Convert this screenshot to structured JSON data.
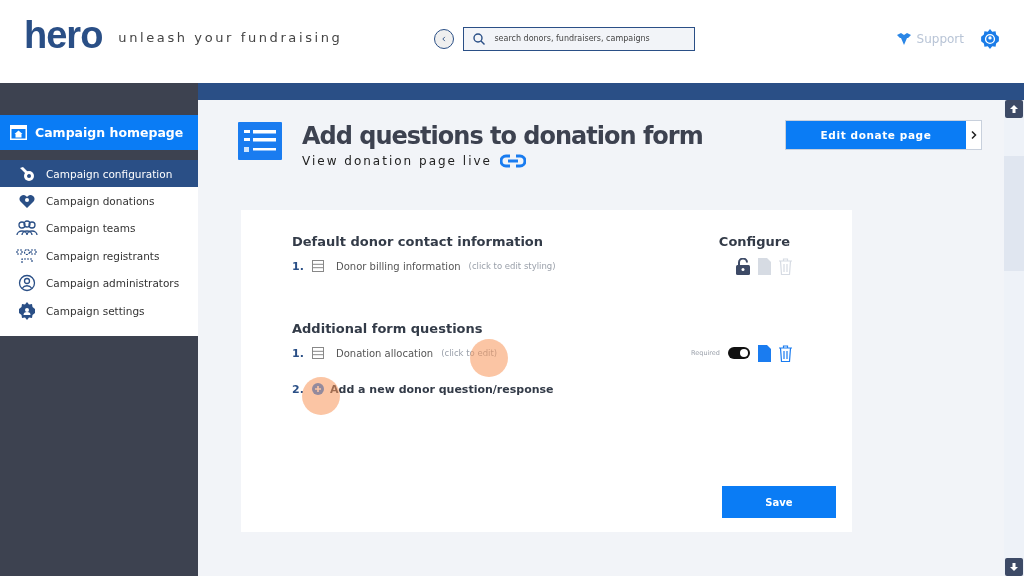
{
  "header": {
    "logo": "hero",
    "tagline": "unleash your fundraising",
    "search": {
      "placeholder": "search donors, fundraisers, campaigns"
    },
    "support": "Support"
  },
  "sidebar": {
    "homepage": "Campaign homepage",
    "items": [
      {
        "label": "Campaign configuration",
        "selected": true
      },
      {
        "label": "Campaign donations",
        "selected": false
      },
      {
        "label": "Campaign teams",
        "selected": false
      },
      {
        "label": "Campaign registrants",
        "selected": false
      },
      {
        "label": "Campaign administrators",
        "selected": false
      },
      {
        "label": "Campaign settings",
        "selected": false
      }
    ]
  },
  "page": {
    "title": "Add questions to donation form",
    "view_link": "View donation page live",
    "edit_button": "Edit donate page"
  },
  "form": {
    "sections": [
      {
        "title": "Default donor contact information",
        "column_title": "Configure",
        "questions": [
          {
            "number": "1.",
            "label": "Donor billing information",
            "hint": "(click to edit styling)",
            "kind": "locked"
          }
        ]
      },
      {
        "title": "Additional form questions",
        "questions": [
          {
            "number": "1.",
            "label": "Donation allocation",
            "hint": "(click to edit)",
            "kind": "editable",
            "required_label": "Required",
            "required": true
          }
        ],
        "add": {
          "number": "2.",
          "label": "Add a new donor question/response"
        }
      }
    ],
    "save_button": "Save"
  }
}
